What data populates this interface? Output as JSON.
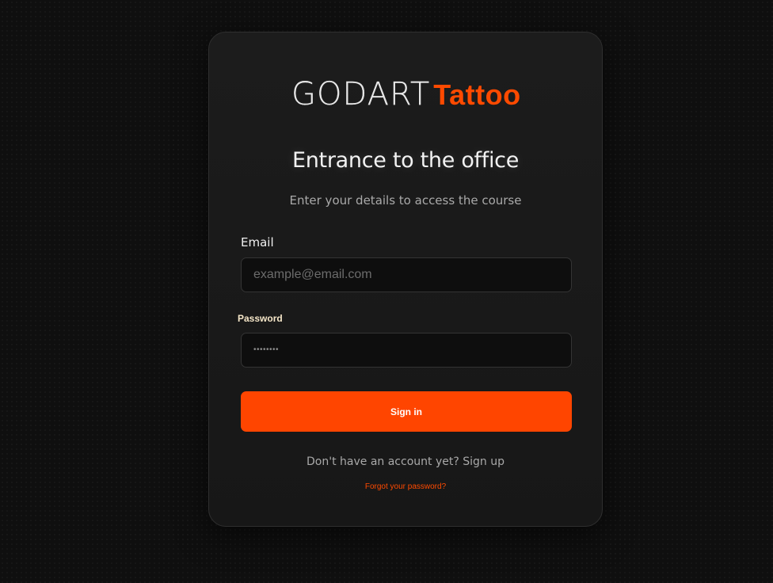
{
  "logo": {
    "part1": "GODART",
    "part2": "Tattoo"
  },
  "title": "Entrance to the office",
  "subtitle": "Enter your details to access the course",
  "email": {
    "label": "Email",
    "placeholder": "example@email.com",
    "value": ""
  },
  "password": {
    "label": "Password",
    "masked_value": "••••••••"
  },
  "signin_label": "Sign in",
  "signup": {
    "prompt": "Don't have an account yet?",
    "link": "Sign up"
  },
  "forgot_link": "Forgot your password?",
  "colors": {
    "accent": "#ff4500",
    "background": "#0f0f0f",
    "card": "#1a1a1a"
  }
}
